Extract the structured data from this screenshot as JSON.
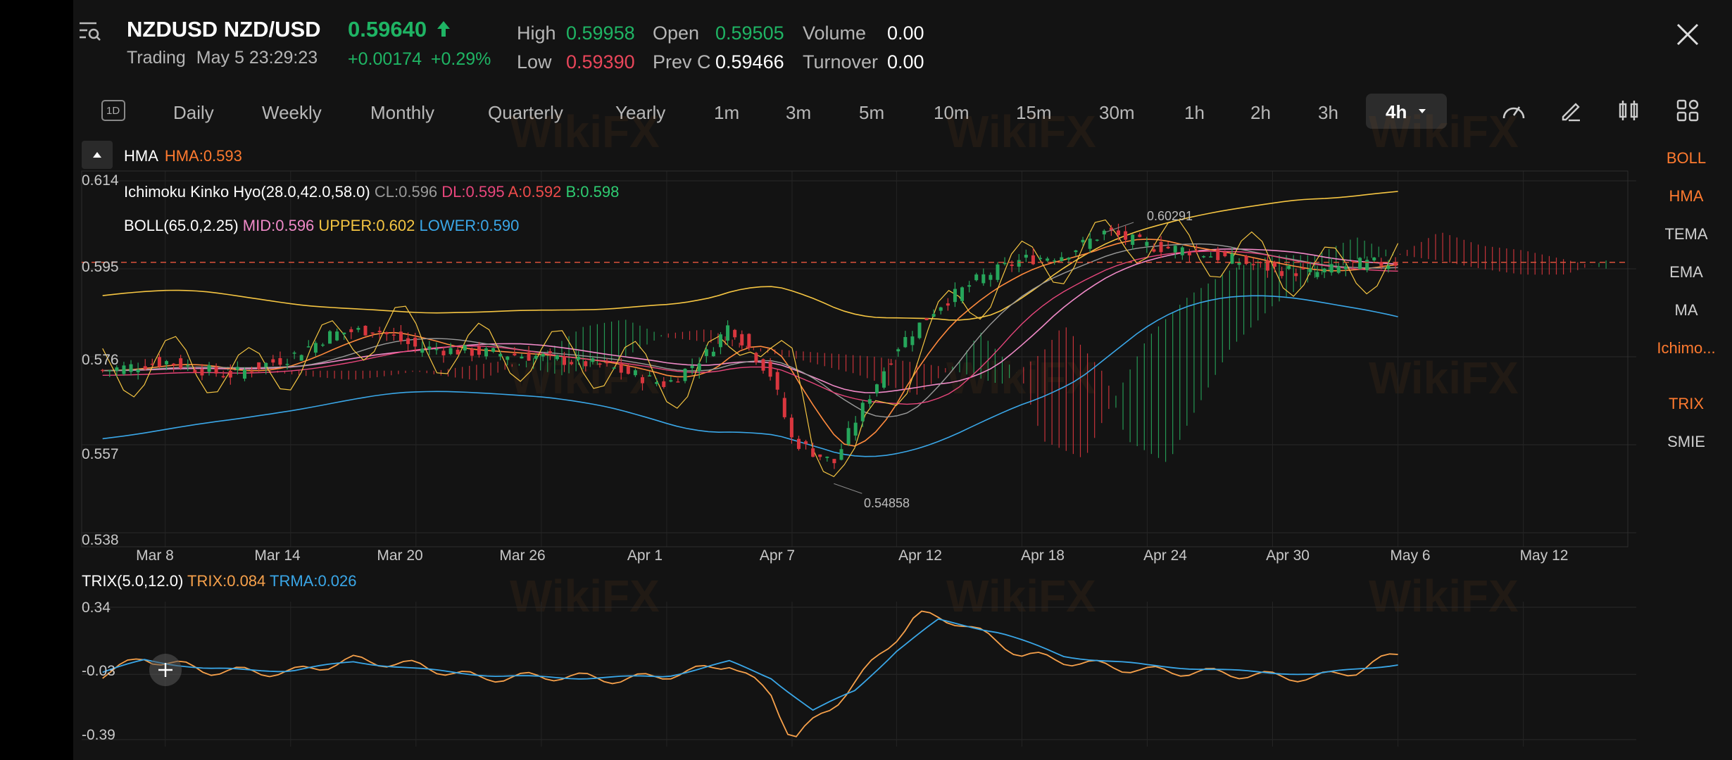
{
  "header": {
    "title": "NZDUSD NZD/USD",
    "price": "0.59640",
    "status": "Trading",
    "datetime": "May 5 23:29:23",
    "change": "+0.00174",
    "change_pct": "+0.29%",
    "stats": {
      "high_label": "High",
      "high": "0.59958",
      "open_label": "Open",
      "open": "0.59505",
      "volume_label": "Volume",
      "volume": "0.00",
      "low_label": "Low",
      "low": "0.59390",
      "prevc_label": "Prev C",
      "prevc": "0.59466",
      "turnover_label": "Turnover",
      "turnover": "0.00"
    }
  },
  "toolbar": {
    "period_badge": "1D",
    "timeframes": [
      "Daily",
      "Weekly",
      "Monthly",
      "Quarterly",
      "Yearly",
      "1m",
      "3m",
      "5m",
      "10m",
      "15m",
      "30m",
      "1h",
      "2h",
      "3h"
    ],
    "active_timeframe": "4h"
  },
  "indicators": {
    "hma": {
      "name": "HMA",
      "value": "HMA:0.593"
    },
    "ichimoku": {
      "name": "Ichimoku Kinko Hyo(28.0,42.0,58.0)",
      "cl": "CL:0.596",
      "dl": "DL:0.595",
      "a": "A:0.592",
      "b": "B:0.598"
    },
    "boll": {
      "name": "BOLL(65.0,2.25)",
      "mid": "MID:0.596",
      "upper": "UPPER:0.602",
      "lower": "LOWER:0.590"
    },
    "trix": {
      "name": "TRIX(5.0,12.0)",
      "trix": "TRIX:0.084",
      "trma": "TRMA:0.026"
    }
  },
  "side_menu": [
    "BOLL",
    "HMA",
    "TEMA",
    "EMA",
    "MA",
    "Ichimo...",
    "TRIX",
    "SMIE"
  ],
  "side_menu_active": [
    "BOLL",
    "HMA",
    "Ichimo...",
    "TRIX"
  ],
  "watermark": "WikiFX",
  "chart_data": [
    {
      "type": "candlestick",
      "title": "NZDUSD 4h",
      "y_ticks": [
        "0.614",
        "0.595",
        "0.576",
        "0.557",
        "0.538"
      ],
      "ylim": [
        0.538,
        0.614
      ],
      "x_ticks": [
        "Mar 8",
        "Mar 14",
        "Mar 20",
        "Mar 26",
        "Apr 1",
        "Apr 7",
        "Apr 12",
        "Apr 18",
        "Apr 24",
        "Apr 30",
        "May 6",
        "May 12"
      ],
      "annotations": [
        {
          "label": "0.60291",
          "kind": "high"
        },
        {
          "label": "0.54858",
          "kind": "low"
        }
      ],
      "current_price_line": 0.5964,
      "close_path": [
        {
          "x": "Mar 5",
          "y": 0.573
        },
        {
          "x": "Mar 8",
          "y": 0.575
        },
        {
          "x": "Mar 11",
          "y": 0.572
        },
        {
          "x": "Mar 14",
          "y": 0.576
        },
        {
          "x": "Mar 16",
          "y": 0.581
        },
        {
          "x": "Mar 18",
          "y": 0.582
        },
        {
          "x": "Mar 20",
          "y": 0.578
        },
        {
          "x": "Mar 23",
          "y": 0.577
        },
        {
          "x": "Mar 26",
          "y": 0.576
        },
        {
          "x": "Mar 29",
          "y": 0.574
        },
        {
          "x": "Apr 1",
          "y": 0.57
        },
        {
          "x": "Apr 3",
          "y": 0.577
        },
        {
          "x": "Apr 4",
          "y": 0.583
        },
        {
          "x": "Apr 6",
          "y": 0.572
        },
        {
          "x": "Apr 7",
          "y": 0.558
        },
        {
          "x": "Apr 9",
          "y": 0.553
        },
        {
          "x": "Apr 10",
          "y": 0.562
        },
        {
          "x": "Apr 12",
          "y": 0.578
        },
        {
          "x": "Apr 14",
          "y": 0.587
        },
        {
          "x": "Apr 16",
          "y": 0.593
        },
        {
          "x": "Apr 18",
          "y": 0.597
        },
        {
          "x": "Apr 20",
          "y": 0.598
        },
        {
          "x": "Apr 22",
          "y": 0.603
        },
        {
          "x": "Apr 24",
          "y": 0.6
        },
        {
          "x": "Apr 26",
          "y": 0.599
        },
        {
          "x": "Apr 28",
          "y": 0.597
        },
        {
          "x": "Apr 30",
          "y": 0.595
        },
        {
          "x": "May 2",
          "y": 0.594
        },
        {
          "x": "May 4",
          "y": 0.596
        },
        {
          "x": "May 6",
          "y": 0.5964
        }
      ]
    },
    {
      "type": "line",
      "title": "TRIX(5.0,12.0)",
      "y_ticks": [
        "0.34",
        "-0.03",
        "-0.39"
      ],
      "ylim": [
        -0.39,
        0.34
      ],
      "series": [
        {
          "name": "TRIX",
          "color": "#f7a14b",
          "points": [
            {
              "x": "Mar 5",
              "y": -0.03
            },
            {
              "x": "Mar 7",
              "y": 0.06
            },
            {
              "x": "Mar 10",
              "y": -0.01
            },
            {
              "x": "Mar 14",
              "y": -0.02
            },
            {
              "x": "Mar 17",
              "y": 0.05
            },
            {
              "x": "Mar 20",
              "y": 0.02
            },
            {
              "x": "Mar 23",
              "y": -0.05
            },
            {
              "x": "Mar 27",
              "y": -0.04
            },
            {
              "x": "Mar 30",
              "y": -0.06
            },
            {
              "x": "Apr 2",
              "y": -0.02
            },
            {
              "x": "Apr 4",
              "y": 0.03
            },
            {
              "x": "Apr 6",
              "y": -0.14
            },
            {
              "x": "Apr 7",
              "y": -0.39
            },
            {
              "x": "Apr 9",
              "y": -0.2
            },
            {
              "x": "Apr 11",
              "y": 0.05
            },
            {
              "x": "Apr 13",
              "y": 0.3
            },
            {
              "x": "Apr 15",
              "y": 0.26
            },
            {
              "x": "Apr 18",
              "y": 0.08
            },
            {
              "x": "Apr 21",
              "y": 0.03
            },
            {
              "x": "Apr 24",
              "y": -0.01
            },
            {
              "x": "Apr 27",
              "y": -0.02
            },
            {
              "x": "Apr 30",
              "y": -0.04
            },
            {
              "x": "May 2",
              "y": -0.05
            },
            {
              "x": "May 4",
              "y": -0.01
            },
            {
              "x": "May 6",
              "y": 0.084
            }
          ]
        },
        {
          "name": "TRMA",
          "color": "#3aa7e8",
          "points": [
            {
              "x": "Mar 5",
              "y": -0.02
            },
            {
              "x": "Mar 7",
              "y": 0.05
            },
            {
              "x": "Mar 10",
              "y": 0.0
            },
            {
              "x": "Mar 14",
              "y": -0.01
            },
            {
              "x": "Mar 17",
              "y": 0.04
            },
            {
              "x": "Mar 20",
              "y": 0.0
            },
            {
              "x": "Mar 24",
              "y": -0.04
            },
            {
              "x": "Mar 28",
              "y": -0.05
            },
            {
              "x": "Apr 1",
              "y": -0.04
            },
            {
              "x": "Apr 4",
              "y": 0.04
            },
            {
              "x": "Apr 6",
              "y": -0.05
            },
            {
              "x": "Apr 8",
              "y": -0.23
            },
            {
              "x": "Apr 10",
              "y": -0.12
            },
            {
              "x": "Apr 12",
              "y": 0.1
            },
            {
              "x": "Apr 14",
              "y": 0.27
            },
            {
              "x": "Apr 17",
              "y": 0.2
            },
            {
              "x": "Apr 20",
              "y": 0.07
            },
            {
              "x": "Apr 24",
              "y": 0.02
            },
            {
              "x": "Apr 28",
              "y": -0.01
            },
            {
              "x": "May 2",
              "y": -0.03
            },
            {
              "x": "May 6",
              "y": 0.026
            }
          ]
        }
      ]
    }
  ]
}
